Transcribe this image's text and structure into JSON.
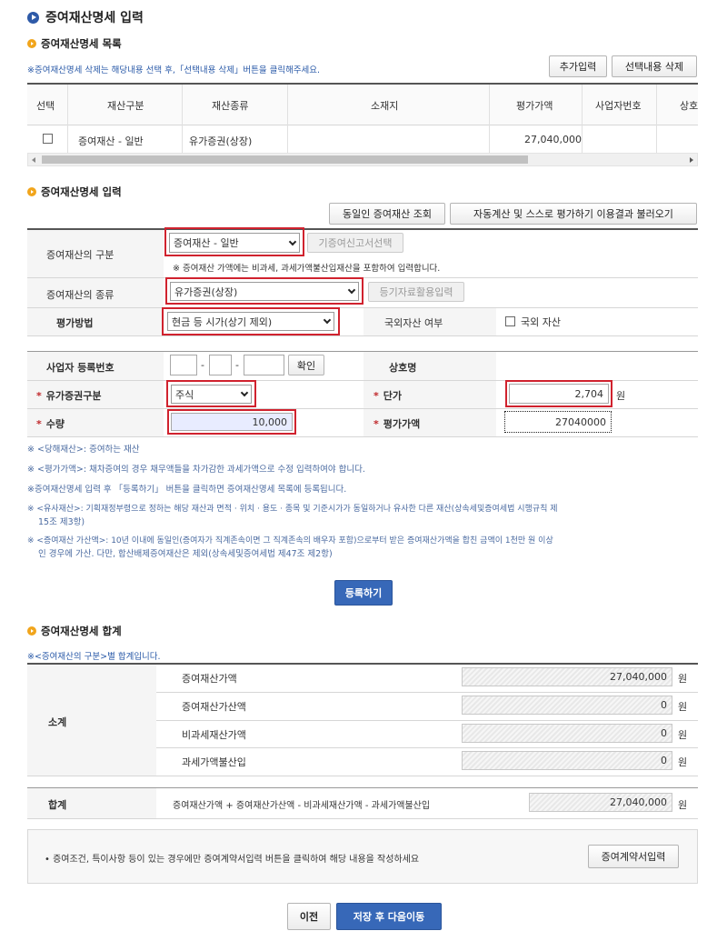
{
  "page_title": "증여재산명세 입력",
  "list_section": {
    "title": "증여재산명세 목록",
    "note": "※증여재산명세 삭제는 해당내용 선택 후,「선택내용 삭제」버튼을 클릭해주세요.",
    "add_button": "추가입력",
    "delete_button": "선택내용 삭제",
    "columns": [
      "선택",
      "재산구분",
      "재산종류",
      "소재지",
      "평가가액",
      "사업자번호",
      "상호"
    ],
    "rows": [
      {
        "category": "증여재산 - 일반",
        "kind": "유가증권(상장)",
        "location": "",
        "value": "27,040,000",
        "biz_no": "",
        "name": ""
      }
    ]
  },
  "input_section": {
    "title": "증여재산명세 입력",
    "same_person_button": "동일인 증여재산 조회",
    "auto_calc_button": "자동계산 및 스스로 평가하기 이용결과 불러오기",
    "category_label": "증여재산의 구분",
    "category_value": "증여재산 - 일반",
    "prior_report_button": "기증여신고서선택",
    "category_note": "※ 증여재산 가액에는 비과세, 과세가액불산입재산을 포함하여 입력합니다.",
    "kind_label": "증여재산의 종류",
    "kind_value": "유가증권(상장)",
    "registry_button": "등기자료활용입력",
    "method_label": "평가방법",
    "method_value": "현금 등 시가(상기 제외)",
    "foreign_label": "국외자산 여부",
    "foreign_option": "국외 자산",
    "biz_no_label": "사업자 등록번호",
    "biz_sep1": "-",
    "biz_sep2": "-",
    "confirm_button": "확인",
    "trade_name_label": "상호명",
    "security_type_label": "유가증권구분",
    "security_type_value": "주식",
    "unit_price_label": "단가",
    "unit_price_value": "2,704",
    "unit_won": "원",
    "quantity_label": "수량",
    "quantity_value": "10,000",
    "eval_value_label": "평가가액",
    "eval_value": "27040000",
    "required_mark": "*"
  },
  "notes": [
    "※ <당해재산>: 증여하는 재산",
    "※ <평가가액>: 채차증여의 경우 채무액들을 차가감한 과세가액으로 수정 입력하여야 합니다.",
    "※증여재산명세 입력 후 「등록하기」 버튼을 클릭하면 증여재산명세 목록에 등록됩니다.",
    "※ <유사재산>: 기획재정부령으로 정하는 해당 재산과 면적 · 위치 · 용도 · 종목 및 기준시가가 동일하거나 유사한 다른 재산(상속세및증여세법 시행규칙 제",
    "15조 제3항)",
    "※ <증여재산 가산액>: 10년 이내에 동일인(증여자가 직계존속이면 그 직계존속의 배우자 포함)으로부터 받은 증여재산가액을 합친 금액이 1천만 원 이상",
    "인 경우에 가산. 다만, 합산배제증여재산은 제외(상속세및증여세법 제47조 제2항)"
  ],
  "register_button": "등록하기",
  "total_section": {
    "title": "증여재산명세 합계",
    "note": "※<증여재산의 구분>별 합계입니다.",
    "subtotal_label": "소계",
    "items": [
      {
        "label": "증여재산가액",
        "value": "27,040,000"
      },
      {
        "label": "증여재산가산액",
        "value": "0"
      },
      {
        "label": "비과세재산가액",
        "value": "0"
      },
      {
        "label": "과세가액불산입",
        "value": "0"
      }
    ],
    "unit": "원",
    "total_label": "합계",
    "total_formula": "증여재산가액 + 증여재산가산액 - 비과세재산가액 - 과세가액불산입",
    "total_value": "27,040,000"
  },
  "contract_note": "• 증여조건, 특이사항 등이 있는 경우에만 증여계약서입력 버튼을 클릭하여 해당 내용을 작성하세요",
  "contract_button": "증여계약서입력",
  "prev_button": "이전",
  "save_next_button": "저장 후 다음이동"
}
